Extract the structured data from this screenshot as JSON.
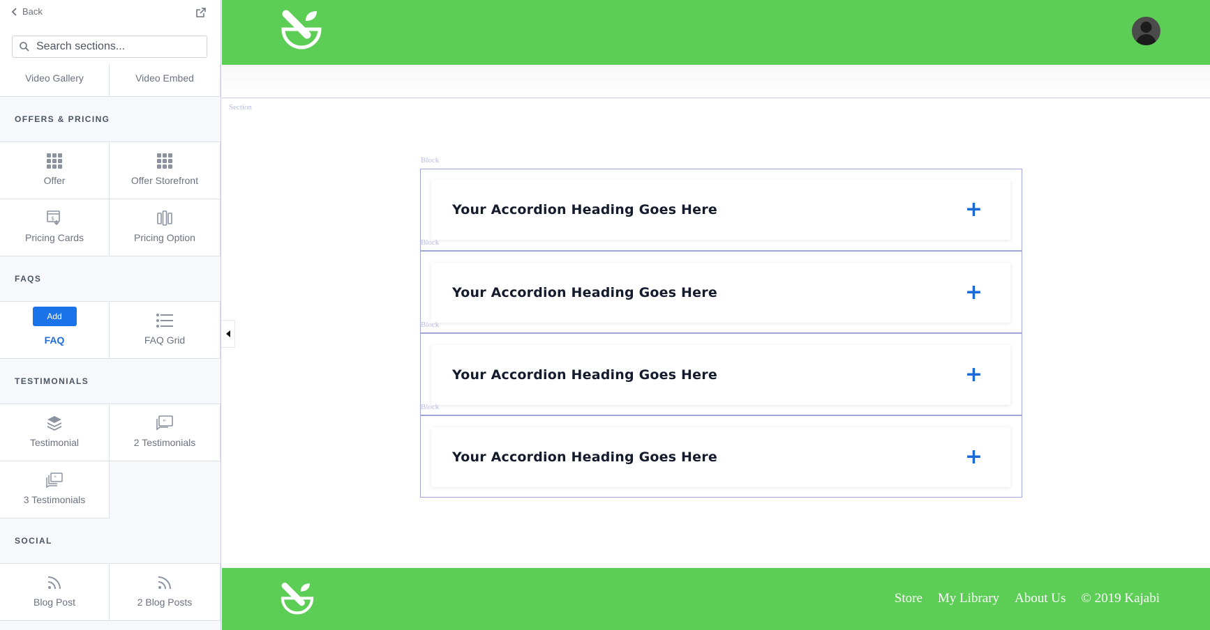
{
  "sidebar": {
    "back_label": "Back",
    "search": {
      "placeholder": "Search sections...",
      "value": ""
    },
    "partial_row": [
      {
        "label": "Video Gallery",
        "icon": "video-gallery-icon"
      },
      {
        "label": "Video Embed",
        "icon": "video-embed-icon"
      }
    ],
    "categories": {
      "offers": {
        "heading": "OFFERS & PRICING",
        "items": [
          {
            "label": "Offer",
            "icon": "grid-icon"
          },
          {
            "label": "Offer Storefront",
            "icon": "grid-icon"
          },
          {
            "label": "Pricing Cards",
            "icon": "pricing-card-icon"
          },
          {
            "label": "Pricing Option",
            "icon": "columns-icon"
          }
        ]
      },
      "faqs": {
        "heading": "FAQS",
        "items": [
          {
            "label": "FAQ",
            "add_label": "Add",
            "active": true
          },
          {
            "label": "FAQ Grid",
            "icon": "list-icon"
          }
        ]
      },
      "testimonials": {
        "heading": "TESTIMONIALS",
        "items": [
          {
            "label": "Testimonial",
            "icon": "layers-icon"
          },
          {
            "label": "2 Testimonials",
            "icon": "quote-icon"
          },
          {
            "label": "3 Testimonials",
            "icon": "quotes-stack-icon"
          }
        ]
      },
      "social": {
        "heading": "SOCIAL",
        "items": [
          {
            "label": "Blog Post",
            "icon": "rss-icon"
          },
          {
            "label": "2 Blog Posts",
            "icon": "rss-icon"
          }
        ]
      }
    }
  },
  "preview": {
    "section_label": "Section",
    "block_label": "Block",
    "accordions": [
      {
        "heading": "Your Accordion Heading Goes Here",
        "toggle": "+"
      },
      {
        "heading": "Your Accordion Heading Goes Here",
        "toggle": "+"
      },
      {
        "heading": "Your Accordion Heading Goes Here",
        "toggle": "+"
      },
      {
        "heading": "Your Accordion Heading Goes Here",
        "toggle": "+"
      }
    ],
    "footer": {
      "links": [
        "Store",
        "My Library",
        "About Us"
      ],
      "copyright": "© 2019 Kajabi"
    }
  },
  "colors": {
    "brand_green": "#5ccd55",
    "accent_blue": "#1a73e8",
    "outline": "#9fa4d9"
  }
}
